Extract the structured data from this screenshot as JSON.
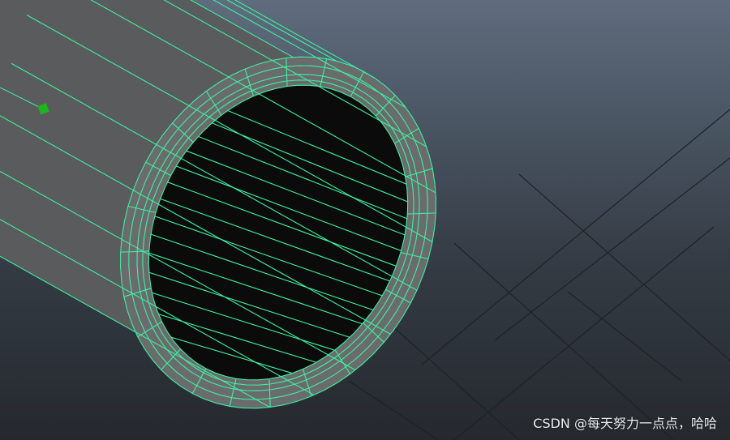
{
  "viewport": {
    "background_top": "#5f6c7d",
    "background_bottom": "#25292e"
  },
  "scene": {
    "object": "hollow-cylinder-mesh",
    "shell_color": "#5a5b5c",
    "shell_highlight": "#6a6b6c",
    "interior_color": "#0b0b0b",
    "wireframe_color": "#3ef0a2",
    "grid_color": "#1e2226",
    "pivot_marker_color": "#1fb51f",
    "pivot_icon": "pivot-manipulator-icon"
  },
  "watermark": {
    "text": "CSDN @每天努力一点点，哈哈"
  }
}
